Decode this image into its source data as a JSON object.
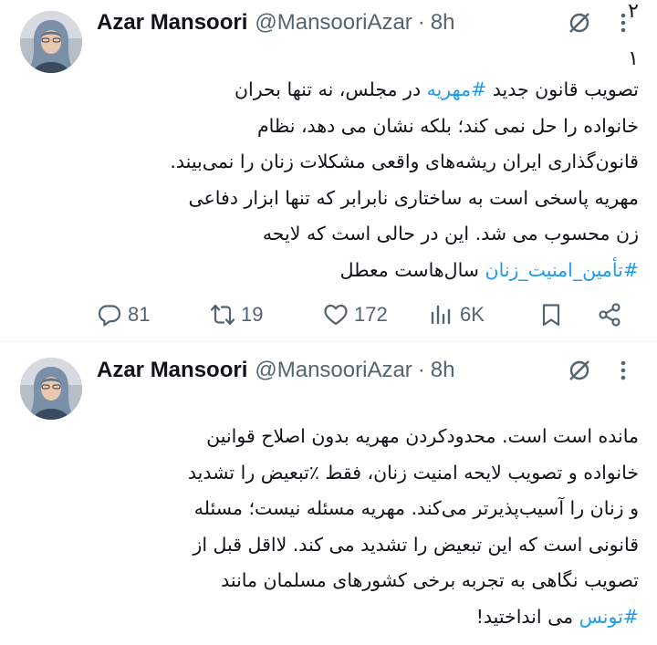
{
  "tweets": [
    {
      "author_name": "Azar Mansoori",
      "handle": "@MansooriAzar",
      "separator": "·",
      "time": "8h",
      "thread_number": "۱",
      "lines": [
        [
          {
            "text": "تصویب قانون جدید "
          },
          {
            "text": "#مهریه",
            "hashtag": true
          },
          {
            "text": " در مجلس، نه تنها بحران"
          }
        ],
        [
          {
            "text": "خانواده را حل نمی کند؛ بلکه نشان می دهد، نظام"
          }
        ],
        [
          {
            "text": "قانون‌گذاری ایران ریشه‌های واقعی مشکلات زنان را نمی‌بیند."
          }
        ],
        [
          {
            "text": "مهریه پاسخی است به ساختاری نابرابر که تنها ابزار دفاعی"
          }
        ],
        [
          {
            "text": "زن محسوب می شد. این در حالی است که لایحه"
          }
        ],
        [
          {
            "text": "#تأمین_امنیت_زنان",
            "hashtag": true
          },
          {
            "text": " سال‌هاست معطل"
          }
        ]
      ],
      "actions": {
        "reply_count": "81",
        "retweet_count": "19",
        "like_count": "172",
        "views_count": "6K"
      }
    },
    {
      "author_name": "Azar Mansoori",
      "handle": "@MansooriAzar",
      "separator": "·",
      "time": "8h",
      "thread_number": "۲",
      "lines": [
        [
          {
            "text": "مانده است است. محدودکردن مهریه بدون اصلاح قوانین"
          }
        ],
        [
          {
            "text": "خانواده و تصویب لایحه امنیت زنان، فقط ٪تبعیض را تشدید"
          }
        ],
        [
          {
            "text": "و زنان را آسیب‌پذیرتر می‌کند. مهریه مسئله نیست؛ مسئله"
          }
        ],
        [
          {
            "text": "قانونی است که این تبعیض را تشدید می کند. لااقل قبل از"
          }
        ],
        [
          {
            "text": "تصویب نگاهی به تجربه برخی کشورهای مسلمان مانند"
          }
        ],
        [
          {
            "text": "#تونس",
            "hashtag": true
          },
          {
            "text": " می انداختید!"
          }
        ]
      ]
    }
  ],
  "colors": {
    "text": "#0f1419",
    "secondary": "#536471",
    "hashtag": "#1d9bf0",
    "separator": "#eff3f4"
  },
  "icons": {
    "reply": "reply-icon",
    "retweet": "retweet-icon",
    "like": "heart-icon",
    "views": "views-icon",
    "bookmark": "bookmark-icon",
    "share": "share-icon",
    "grok": "grok-icon",
    "more": "more-icon"
  }
}
